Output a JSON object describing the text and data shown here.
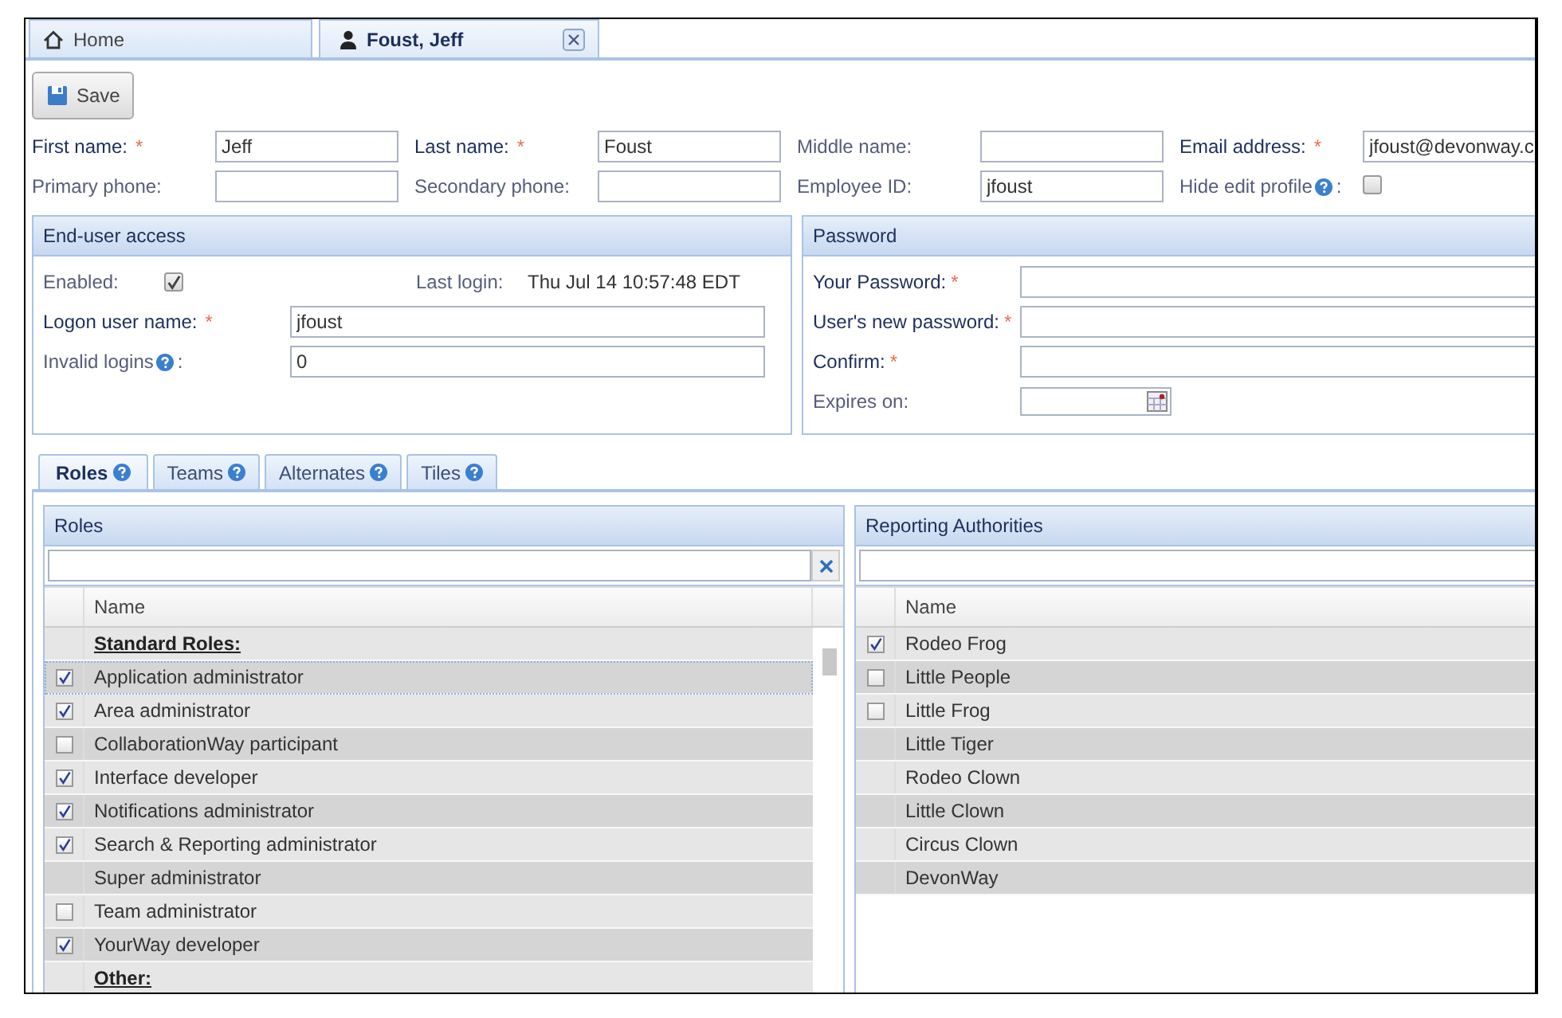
{
  "required_mark": "*",
  "tabs": [
    {
      "label": "Home",
      "selected": false,
      "closable": false
    },
    {
      "label": "Foust, Jeff",
      "selected": true,
      "closable": true
    }
  ],
  "toolbar": {
    "save_label": "Save"
  },
  "fields": [
    {
      "kind": "text",
      "label": "First name:",
      "value": "Jeff",
      "required": true,
      "help": false
    },
    {
      "kind": "text",
      "label": "Last name:",
      "value": "Foust",
      "required": true,
      "help": false
    },
    {
      "kind": "text",
      "label": "Middle name:",
      "required": false,
      "help": false
    },
    {
      "kind": "text",
      "label": "Email address:",
      "value": "jfoust@devonway.c",
      "required": true,
      "help": false
    },
    {
      "kind": "text",
      "label": "Primary phone:",
      "required": false,
      "help": false
    },
    {
      "kind": "text",
      "label": "Secondary phone:",
      "required": false,
      "help": false
    },
    {
      "kind": "text",
      "label": "Employee ID:",
      "value": "jfoust",
      "required": false,
      "help": false
    },
    {
      "kind": "checkbox",
      "label": "Hide edit profile",
      "colon": ":",
      "checked": false,
      "required": false,
      "help": true
    }
  ],
  "end_user_access": {
    "title": "End-user access",
    "enabled_label": "Enabled:",
    "enabled": true,
    "last_login_label": "Last login:",
    "last_login": "Thu Jul 14 10:57:48 EDT",
    "fields": [
      {
        "label": "Logon user name:",
        "value": "jfoust",
        "required": true,
        "help": false
      },
      {
        "label": "Invalid logins",
        "colon": ":",
        "value": "0",
        "required": false,
        "help": true
      }
    ]
  },
  "password": {
    "title": "Password",
    "fields": [
      {
        "kind": "text",
        "label": "Your Password:",
        "required": true
      },
      {
        "kind": "text",
        "label": "User's new password:",
        "required": true
      },
      {
        "kind": "text",
        "label": "Confirm:",
        "required": true
      },
      {
        "kind": "date",
        "label": "Expires on:",
        "required": false
      }
    ]
  },
  "sub_tabs": [
    {
      "label": "Roles",
      "selected": true
    },
    {
      "label": "Teams",
      "selected": false
    },
    {
      "label": "Alternates",
      "selected": false
    },
    {
      "label": "Tiles",
      "selected": false
    }
  ],
  "roles": {
    "title": "Roles",
    "column": "Name",
    "clearable": true,
    "scrollbar": true,
    "rows": [
      {
        "kind": "heading",
        "name": "Standard Roles:",
        "selected": false
      },
      {
        "kind": "checkbox",
        "name": "Application administrator",
        "checked": true,
        "selected": true
      },
      {
        "kind": "checkbox",
        "name": "Area administrator",
        "checked": true,
        "selected": false
      },
      {
        "kind": "checkbox",
        "name": "CollaborationWay participant",
        "checked": false,
        "selected": false
      },
      {
        "kind": "checkbox",
        "name": "Interface developer",
        "checked": true,
        "selected": false
      },
      {
        "kind": "checkbox",
        "name": "Notifications administrator",
        "checked": true,
        "selected": false
      },
      {
        "kind": "checkbox",
        "name": "Search & Reporting administrator",
        "checked": true,
        "selected": false
      },
      {
        "kind": "plain",
        "name": "Super administrator",
        "selected": false
      },
      {
        "kind": "checkbox",
        "name": "Team administrator",
        "checked": false,
        "selected": false
      },
      {
        "kind": "checkbox",
        "name": "YourWay developer",
        "checked": true,
        "selected": false
      },
      {
        "kind": "heading",
        "name": "Other:",
        "selected": false
      }
    ]
  },
  "reporting_authorities": {
    "title": "Reporting Authorities",
    "column": "Name",
    "clearable": false,
    "scrollbar": false,
    "rows": [
      {
        "kind": "checkbox",
        "name": "Rodeo Frog",
        "checked": true,
        "selected": false
      },
      {
        "kind": "checkbox",
        "name": "Little People",
        "checked": false,
        "selected": false
      },
      {
        "kind": "checkbox",
        "name": "Little Frog",
        "checked": false,
        "selected": false
      },
      {
        "kind": "plain",
        "name": "Little Tiger",
        "selected": false
      },
      {
        "kind": "plain",
        "name": "Rodeo Clown",
        "selected": false
      },
      {
        "kind": "plain",
        "name": "Little Clown",
        "selected": false
      },
      {
        "kind": "plain",
        "name": "Circus Clown",
        "selected": false
      },
      {
        "kind": "plain",
        "name": "DevonWay",
        "selected": false
      }
    ]
  }
}
